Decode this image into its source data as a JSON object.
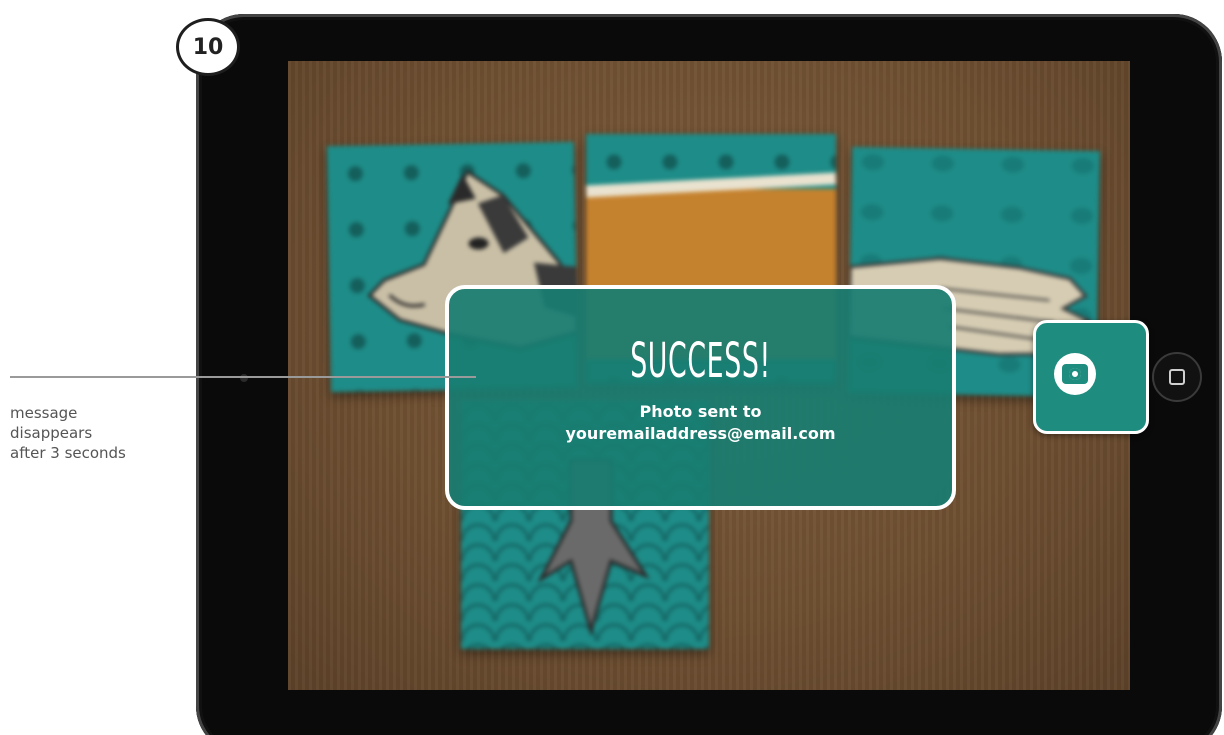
{
  "step_badge": {
    "number": "10"
  },
  "annotation": {
    "lines": [
      "message",
      "disappears",
      "after 3 seconds"
    ]
  },
  "screen": {
    "background": "wood",
    "cards": [
      {
        "name": "cow-head-card",
        "pattern": "dots"
      },
      {
        "name": "middle-top-card",
        "pattern": "dots"
      },
      {
        "name": "hand-card",
        "pattern": "plain"
      },
      {
        "name": "fish-tail-card",
        "pattern": "scales"
      }
    ],
    "camera_button": {
      "icon": "camera-icon"
    }
  },
  "toast": {
    "title": "SUCCESS!",
    "message_line1": "Photo sent to",
    "message_line2": "youremailaddress@email.com"
  },
  "colors": {
    "toast": "#197D71",
    "card": "#1E8C88",
    "wood": "#6C4D30"
  }
}
